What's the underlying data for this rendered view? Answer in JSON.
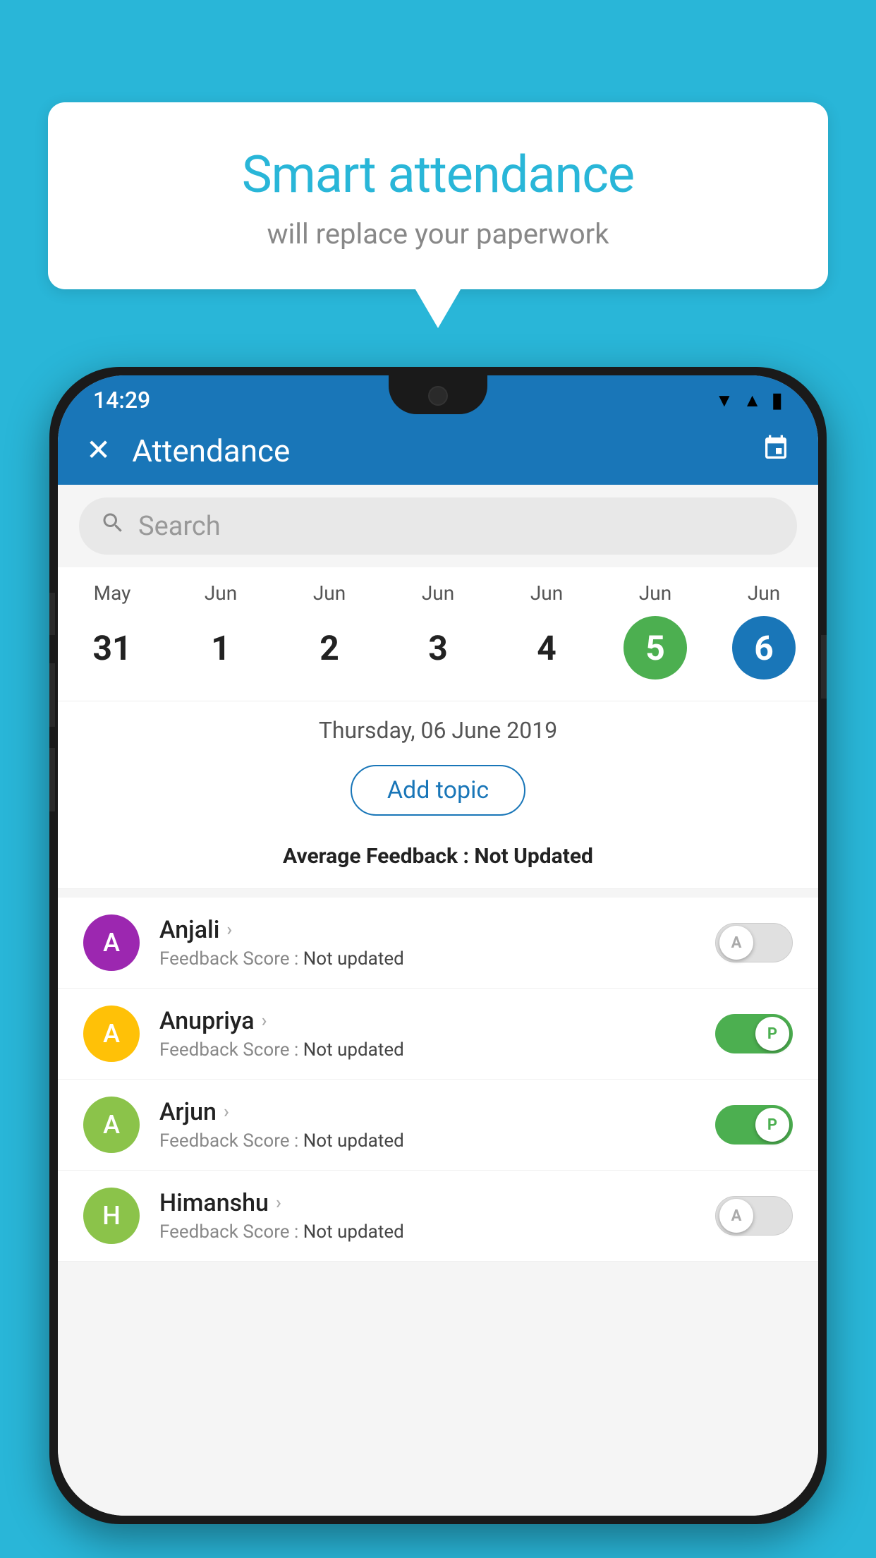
{
  "background_color": "#29b6d8",
  "speech_bubble": {
    "title": "Smart attendance",
    "subtitle": "will replace your paperwork"
  },
  "status_bar": {
    "time": "14:29"
  },
  "app_bar": {
    "title": "Attendance"
  },
  "search": {
    "placeholder": "Search"
  },
  "calendar": {
    "days": [
      {
        "month": "May",
        "date": "31"
      },
      {
        "month": "Jun",
        "date": "1"
      },
      {
        "month": "Jun",
        "date": "2"
      },
      {
        "month": "Jun",
        "date": "3"
      },
      {
        "month": "Jun",
        "date": "4"
      },
      {
        "month": "Jun",
        "date": "5",
        "state": "green"
      },
      {
        "month": "Jun",
        "date": "6",
        "state": "blue"
      }
    ],
    "selected_date": "Thursday, 06 June 2019"
  },
  "add_topic_label": "Add topic",
  "average_feedback": {
    "label": "Average Feedback : ",
    "value": "Not Updated"
  },
  "students": [
    {
      "name": "Anjali",
      "avatar_letter": "A",
      "avatar_color": "#9c27b0",
      "feedback_label": "Feedback Score : ",
      "feedback_value": "Not updated",
      "toggle_state": "off",
      "toggle_label": "A"
    },
    {
      "name": "Anupriya",
      "avatar_letter": "A",
      "avatar_color": "#ffc107",
      "feedback_label": "Feedback Score : ",
      "feedback_value": "Not updated",
      "toggle_state": "on",
      "toggle_label": "P"
    },
    {
      "name": "Arjun",
      "avatar_letter": "A",
      "avatar_color": "#8bc34a",
      "feedback_label": "Feedback Score : ",
      "feedback_value": "Not updated",
      "toggle_state": "on",
      "toggle_label": "P"
    },
    {
      "name": "Himanshu",
      "avatar_letter": "H",
      "avatar_color": "#8bc34a",
      "feedback_label": "Feedback Score : ",
      "feedback_value": "Not updated",
      "toggle_state": "off",
      "toggle_label": "A"
    }
  ]
}
